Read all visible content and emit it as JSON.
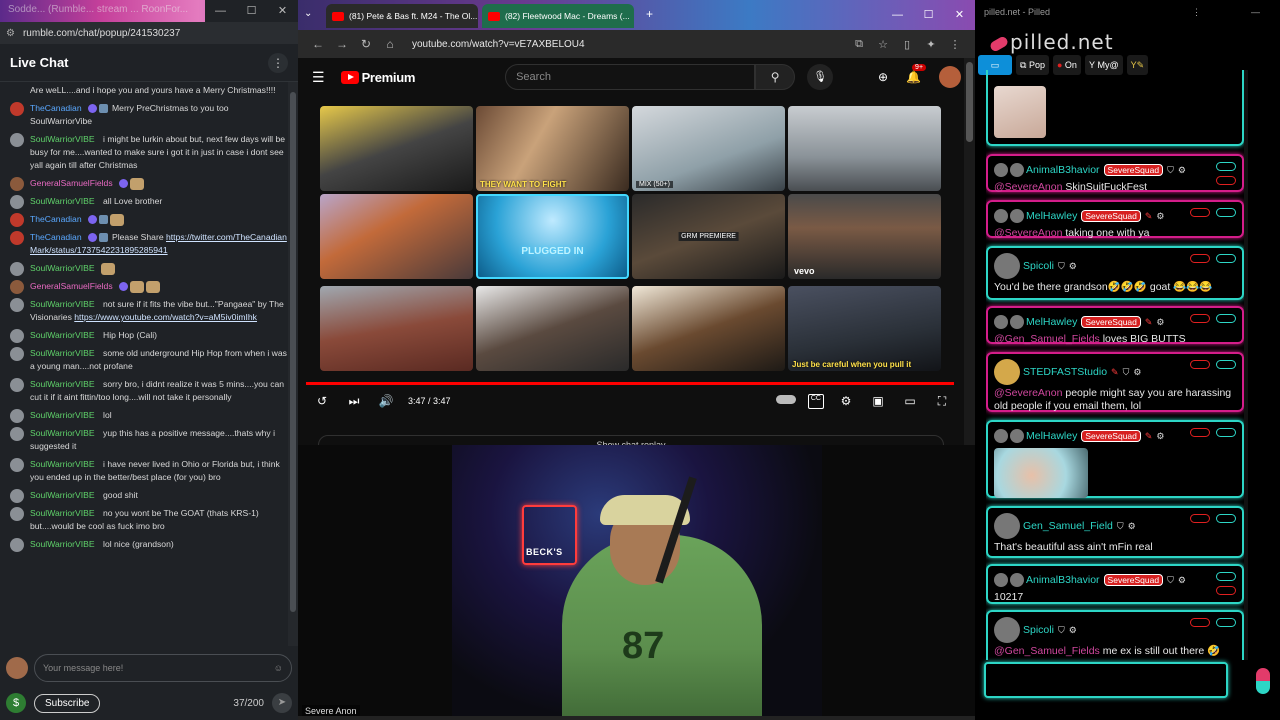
{
  "rumble": {
    "tab_title": "Sodde... (Rumble... stream ... RoonFor...",
    "url": "rumble.com/chat/popup/241530237",
    "header": "Live Chat",
    "messages": [
      {
        "user": "",
        "text": "Are weLL....and i hope you and yours have a Merry Christmas!!!!"
      },
      {
        "user": "TheCanadian",
        "text": "Merry PreChristmas to you too SoulWarriorVibe"
      },
      {
        "user": "SoulWarriorVIBE",
        "text": "i might be lurkin about but, next few days will be busy for me....wanted to make sure i got it in just in case i dont see yall again till after Christmas"
      },
      {
        "user": "GeneralSamuelFields",
        "text": ""
      },
      {
        "user": "SoulWarriorVIBE",
        "text": "all Love brother"
      },
      {
        "user": "TheCanadian",
        "text": ""
      },
      {
        "user": "TheCanadian",
        "text": "Please Share",
        "link": "https://twitter.com/TheCanadianMark/status/1737542231895285941"
      },
      {
        "user": "SoulWarriorVIBE",
        "text": ""
      },
      {
        "user": "GeneralSamuelFields",
        "text": ""
      },
      {
        "user": "SoulWarriorVIBE",
        "text": "not sure if it fits the vibe but...\"Pangaea\" by The Visionaries",
        "link": "https://www.youtube.com/watch?v=aM5iv0imIhk"
      },
      {
        "user": "SoulWarriorVIBE",
        "text": "Hip Hop (Cali)"
      },
      {
        "user": "SoulWarriorVIBE",
        "text": "some old underground Hip Hop from when i was a young man....not profane"
      },
      {
        "user": "SoulWarriorVIBE",
        "text": "sorry bro, i didnt realize it was 5 mins....you can cut it if it aint fittin/too long....will not take it personally"
      },
      {
        "user": "SoulWarriorVIBE",
        "text": "lol"
      },
      {
        "user": "SoulWarriorVIBE",
        "text": "yup this has a positive message....thats why i suggested it"
      },
      {
        "user": "SoulWarriorVIBE",
        "text": "i have never lived in Ohio or Florida but, i think you ended up in the better/best place (for you) bro"
      },
      {
        "user": "SoulWarriorVIBE",
        "text": "good shit"
      },
      {
        "user": "SoulWarriorVIBE",
        "text": "no you wont be The GOAT (thats KRS-1) but....would be cool as fuck imo bro"
      },
      {
        "user": "SoulWarriorVIBE",
        "text": "lol nice (grandson)"
      }
    ],
    "input_placeholder": "Your message here!",
    "subscribe": "Subscribe",
    "char_count": "37/200"
  },
  "youtube": {
    "tabs": [
      "(81) Pete & Bas ft. M24 - The Ol...",
      "(82) Fleetwood Mac - Dreams (..."
    ],
    "url": "youtube.com/watch?v=vE7AXBELOU4",
    "logo": "Premium",
    "search_placeholder": "Search",
    "notif_count": "9+",
    "thumbs": [
      {
        "caption": ""
      },
      {
        "caption": "THEY WANT TO FIGHT"
      },
      {
        "caption": "MIX (50+)"
      },
      {
        "caption": ""
      },
      {
        "caption": ""
      },
      {
        "caption": "PLUGGED IN"
      },
      {
        "caption": "GRM PREMIERE"
      },
      {
        "caption": "vevo"
      },
      {
        "caption": ""
      },
      {
        "caption": ""
      },
      {
        "caption": ""
      },
      {
        "caption": "Just be careful when you pull it"
      }
    ],
    "time": "3:47 / 3:47",
    "chat_replay": "Show chat replay"
  },
  "cam": {
    "sign": "BECK'S",
    "jersey": "87",
    "caption": "Severe Anon"
  },
  "pilled": {
    "window_title": "pilled.net - Pilled",
    "brand": "pilled.net",
    "toolbar": [
      "Pop",
      "On",
      "My@"
    ],
    "posts": [
      {
        "user": "AnimalB3havior",
        "tag": "SevereSquad",
        "mention": "@SevereAnon",
        "text": "SkinSuitFuckFest"
      },
      {
        "user": "MelHawley",
        "tag": "SevereSquad",
        "mention": "@SevereAnon",
        "text": "taking one with ya"
      },
      {
        "user": "Spicoli",
        "tag": "",
        "mention": "",
        "text": "You'd be there grandson🤣🤣🤣 goat 😂😂😂"
      },
      {
        "user": "MelHawley",
        "tag": "SevereSquad",
        "mention": "@Gen_Samuel_Fields",
        "text": "loves BIG BUTTS"
      },
      {
        "user": "STEDFASTStudio",
        "tag": "",
        "mention": "@SevereAnon",
        "text": "people might say you are harassing old people if you email them, lol"
      },
      {
        "user": "MelHawley",
        "tag": "SevereSquad",
        "mention": "",
        "text": ""
      },
      {
        "user": "Gen_Samuel_Field",
        "tag": "",
        "mention": "",
        "text": "That's beautiful ass ain't mFin real"
      },
      {
        "user": "AnimalB3havior",
        "tag": "SevereSquad",
        "mention": "",
        "text": "10217"
      },
      {
        "user": "Spicoli",
        "tag": "",
        "mention": "@Gen_Samuel_Fields",
        "text": "me ex is still out there 🤣"
      }
    ]
  }
}
